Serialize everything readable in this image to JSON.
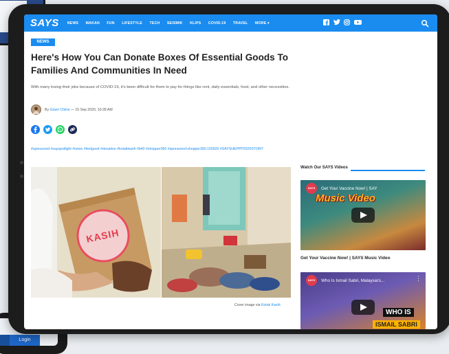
{
  "background": {
    "login_label": "Login"
  },
  "nav": {
    "logo": "SAYS",
    "items": [
      "NEWS",
      "MAKAN",
      "FUN",
      "LIFESTYLE",
      "TECH",
      "SEISMIK",
      "KLIPS",
      "COVID-19",
      "TRAVEL",
      "MORE ▾"
    ],
    "social_icons": [
      "facebook-icon",
      "twitter-icon",
      "instagram-icon",
      "youtube-icon"
    ],
    "brand_color": "#1a8cf0"
  },
  "article": {
    "tag": "NEWS",
    "title": "Here's How You Can Donate Boxes Of Essential Goods To Families And Communities In Need",
    "summary": "With many losing their jobs because of COVID-19, it's been difficult for them to pay for things like rent, daily essentials, food, and other necessities.",
    "byline_prefix": "By",
    "author": "Gowri Chitra",
    "date": "— 15 Sep 2020, 10:28 AM",
    "share_icons": [
      "facebook-share-icon",
      "twitter-share-icon",
      "whatsapp-share-icon",
      "link-share-icon"
    ],
    "hashtags": "#sponsored #sayspotlight #news #feelgood #donation #kotakkasih #b40 #shopper360 #sponsored:shopper360:150920 #SAYSHEPPP2020STORY",
    "box_logo_text": "KASIH",
    "caption_prefix": "Cover image via",
    "caption_link": "Kotak Kasih"
  },
  "sidebar": {
    "heading": "Watch Our SAYS Videos",
    "videos": [
      {
        "channel": "SAYS",
        "title": "Get Your Vaccine Now! | SAYS Music Video",
        "overlay_title": "Get Your Vaccine Now! | SAY",
        "banner": "Music Video",
        "caption": "Get Your Vaccine Now! | SAYS Music Video"
      },
      {
        "channel": "SAYS",
        "overlay_title": "Who Is Ismail Sabri, Malaysia's...",
        "whois": "WHO IS",
        "name_strip": "ISMAIL SABRI"
      }
    ]
  }
}
